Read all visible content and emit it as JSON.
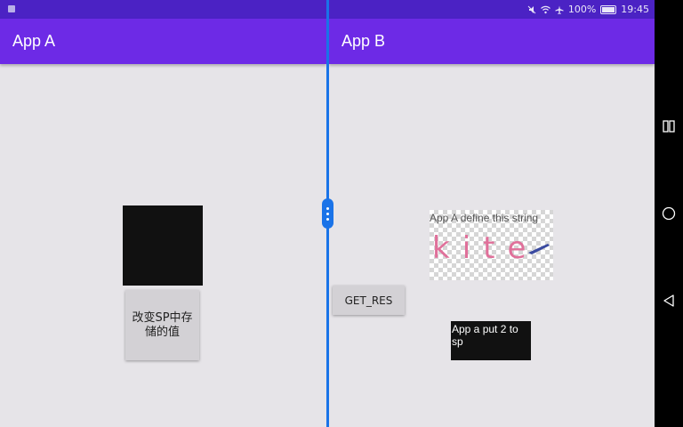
{
  "status_bar": {
    "battery": "100%",
    "time": "19:45",
    "icons": [
      "notification-icon",
      "mute-icon",
      "wifi-icon",
      "airplane-icon",
      "battery-icon"
    ]
  },
  "app_a": {
    "title": "App A",
    "change_button_label": "改变SP中存储的值"
  },
  "app_b": {
    "title": "App B",
    "get_res_label": "GET_RES",
    "image_caption": "App A define this string",
    "image_text": "kite",
    "result_text": "App a put 2 to sp"
  },
  "colors": {
    "status_bar": "#4b22c4",
    "app_bar": "#6d2ae6",
    "divider": "#1a73e8",
    "background": "#e6e4e8"
  },
  "nav_bar": {
    "icons": [
      "multi-window-icon",
      "home-icon",
      "back-icon"
    ]
  }
}
